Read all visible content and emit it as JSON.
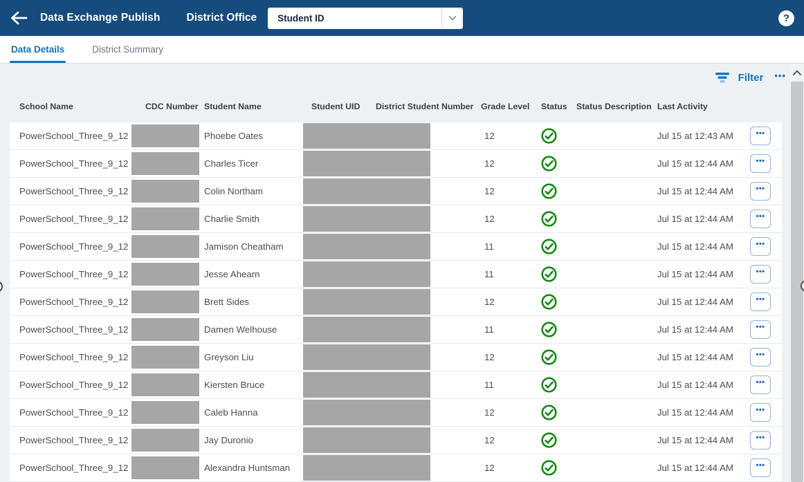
{
  "header": {
    "title": "Data Exchange Publish",
    "subtitle": "District Office",
    "dropdown": {
      "value": "Student ID"
    },
    "help_label": "?"
  },
  "tabs": [
    {
      "label": "Data Details",
      "active": true
    },
    {
      "label": "District Summary",
      "active": false
    }
  ],
  "toolbar": {
    "filter_label": "Filter",
    "more_label": "•••"
  },
  "table": {
    "columns": [
      "School Name",
      "CDC Number",
      "Student Name",
      "Student UID",
      "District Student Number",
      "Grade Level",
      "Status",
      "Status Description",
      "Last Activity"
    ],
    "row_actions_label": "•••",
    "redacted_fields": [
      "CDC Number",
      "Student UID",
      "District Student Number"
    ],
    "rows": [
      {
        "school": "PowerSchool_Three_9_12",
        "student": "Phoebe Oates",
        "grade": "12",
        "status": "success",
        "status_description": "",
        "last_activity": "Jul 15 at 12:43 AM"
      },
      {
        "school": "PowerSchool_Three_9_12",
        "student": "Charles Ticer",
        "grade": "12",
        "status": "success",
        "status_description": "",
        "last_activity": "Jul 15 at 12:44 AM"
      },
      {
        "school": "PowerSchool_Three_9_12",
        "student": "Colin Northam",
        "grade": "12",
        "status": "success",
        "status_description": "",
        "last_activity": "Jul 15 at 12:44 AM"
      },
      {
        "school": "PowerSchool_Three_9_12",
        "student": "Charlie Smith",
        "grade": "12",
        "status": "success",
        "status_description": "",
        "last_activity": "Jul 15 at 12:44 AM"
      },
      {
        "school": "PowerSchool_Three_9_12",
        "student": "Jamison Cheatham",
        "grade": "11",
        "status": "success",
        "status_description": "",
        "last_activity": "Jul 15 at 12:44 AM"
      },
      {
        "school": "PowerSchool_Three_9_12",
        "student": "Jesse Ahearn",
        "grade": "11",
        "status": "success",
        "status_description": "",
        "last_activity": "Jul 15 at 12:44 AM"
      },
      {
        "school": "PowerSchool_Three_9_12",
        "student": "Brett Sides",
        "grade": "12",
        "status": "success",
        "status_description": "",
        "last_activity": "Jul 15 at 12:44 AM"
      },
      {
        "school": "PowerSchool_Three_9_12",
        "student": "Damen Welhouse",
        "grade": "11",
        "status": "success",
        "status_description": "",
        "last_activity": "Jul 15 at 12:44 AM"
      },
      {
        "school": "PowerSchool_Three_9_12",
        "student": "Greyson Liu",
        "grade": "12",
        "status": "success",
        "status_description": "",
        "last_activity": "Jul 15 at 12:44 AM"
      },
      {
        "school": "PowerSchool_Three_9_12",
        "student": "Kiersten Bruce",
        "grade": "11",
        "status": "success",
        "status_description": "",
        "last_activity": "Jul 15 at 12:44 AM"
      },
      {
        "school": "PowerSchool_Three_9_12",
        "student": "Caleb Hanna",
        "grade": "12",
        "status": "success",
        "status_description": "",
        "last_activity": "Jul 15 at 12:44 AM"
      },
      {
        "school": "PowerSchool_Three_9_12",
        "student": "Jay Duronio",
        "grade": "12",
        "status": "success",
        "status_description": "",
        "last_activity": "Jul 15 at 12:44 AM"
      },
      {
        "school": "PowerSchool_Three_9_12",
        "student": "Alexandra Huntsman",
        "grade": "12",
        "status": "success",
        "status_description": "",
        "last_activity": "Jul 15 at 12:44 AM"
      }
    ]
  },
  "colors": {
    "navy_header": "#164b7e",
    "accent_blue": "#1173c1",
    "action_blue": "#1565c0",
    "success_green": "#118b11",
    "redaction_gray": "#a6a6a6",
    "content_bg": "#eef1f3"
  }
}
